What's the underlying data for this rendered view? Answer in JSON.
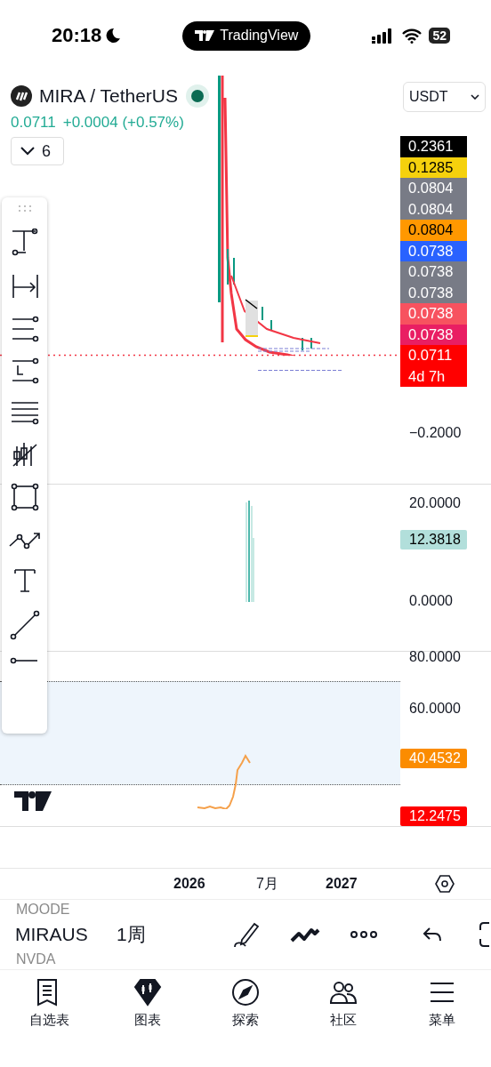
{
  "status_bar": {
    "time": "20:18",
    "app_pill": "TradingView",
    "battery": "52"
  },
  "header": {
    "symbol": "MIRA / TetherUS",
    "price": "0.0711",
    "change": "+0.0004 (+0.57%)",
    "currency": "USDT",
    "indicator_count": "6"
  },
  "main_pane": {
    "price_labels": [
      {
        "value": "0.2361",
        "color": "#000000"
      },
      {
        "value": "0.1285",
        "color": "#f5d10d"
      },
      {
        "value": "0.0804",
        "color": "#787b86"
      },
      {
        "value": "0.0804",
        "color": "#787b86"
      },
      {
        "value": "0.0804",
        "color": "#ff9800"
      },
      {
        "value": "0.0738",
        "color": "#2962ff"
      },
      {
        "value": "0.0738",
        "color": "#787b86"
      },
      {
        "value": "0.0738",
        "color": "#787b86"
      },
      {
        "value": "0.0738",
        "color": "#f7525f"
      },
      {
        "value": "0.0738",
        "color": "#e91e63"
      },
      {
        "value": "0.0711",
        "sub": "4d 7h",
        "color": "#ff0000"
      }
    ],
    "axis_labels": [
      "−0.2000"
    ]
  },
  "volume_pane": {
    "axis_labels": [
      "20.0000",
      "0.0000"
    ],
    "badge": {
      "value": "12.3818",
      "color": "#b2dfdb"
    }
  },
  "rsi_pane": {
    "axis_labels": [
      "80.0000",
      "60.0000"
    ],
    "badges": [
      {
        "value": "40.4532",
        "color": "#fb8c00"
      },
      {
        "value": "12.2475",
        "color": "#ff0000"
      }
    ]
  },
  "time_axis": {
    "labels": [
      {
        "text": "2026",
        "kind": "year"
      },
      {
        "text": "7月",
        "kind": "month"
      },
      {
        "text": "2027",
        "kind": "year"
      }
    ]
  },
  "toolbar": {
    "symbol_above": "MOODE",
    "symbol": "MIRAUS",
    "symbol_below": "NVDA",
    "interval": "1周"
  },
  "tab_bar": {
    "items": [
      {
        "label": "自选表",
        "selected": false
      },
      {
        "label": "图表",
        "selected": true
      },
      {
        "label": "探索",
        "selected": false
      },
      {
        "label": "社区",
        "selected": false
      },
      {
        "label": "菜单",
        "selected": false
      }
    ]
  }
}
